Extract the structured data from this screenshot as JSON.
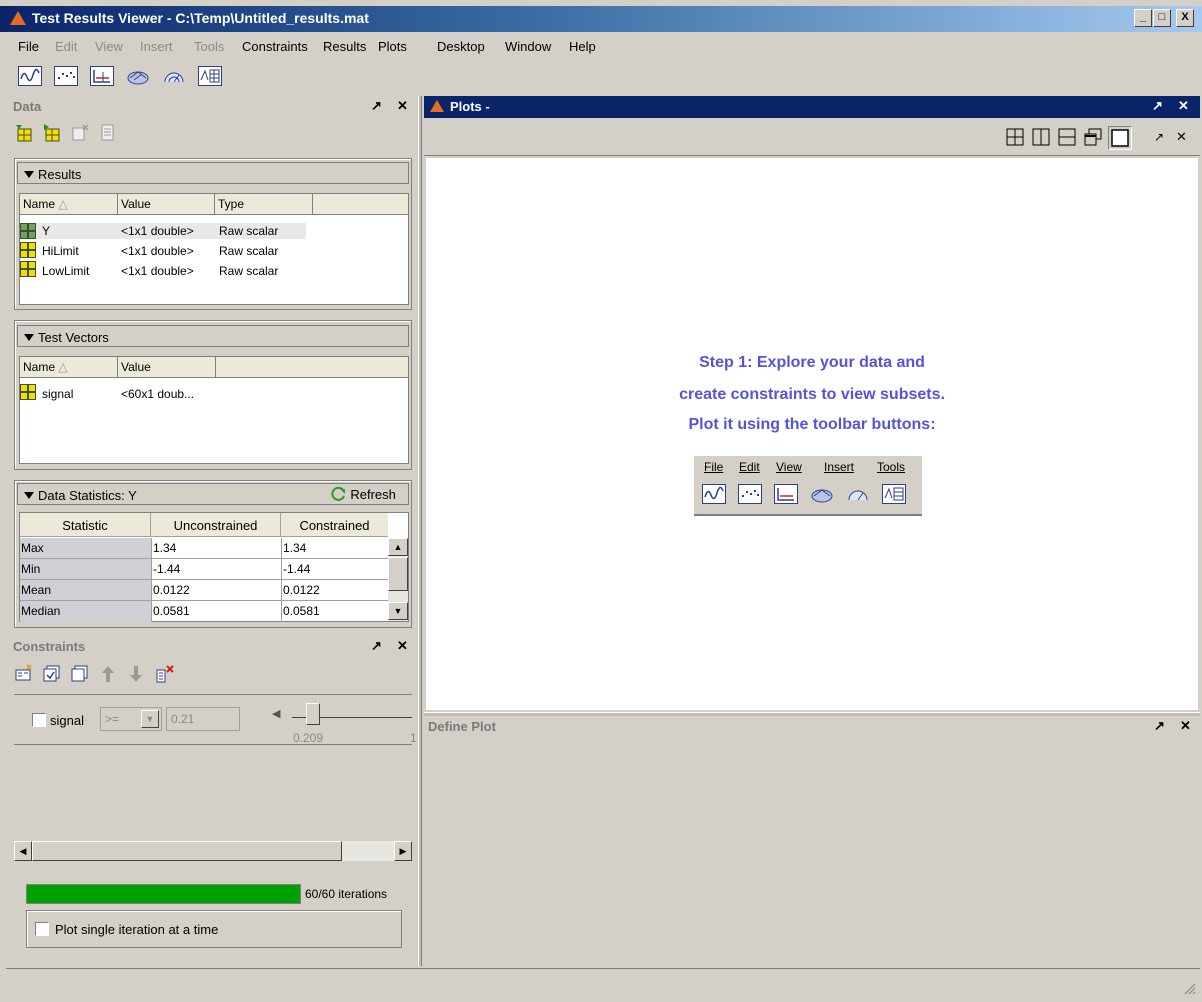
{
  "window": {
    "title": "Test Results Viewer - C:\\Temp\\Untitled_results.mat",
    "min": "_",
    "max": "□",
    "close": "X"
  },
  "menu": [
    {
      "label": "File",
      "enabled": true
    },
    {
      "label": "Edit",
      "enabled": false
    },
    {
      "label": "View",
      "enabled": false
    },
    {
      "label": "Insert",
      "enabled": false
    },
    {
      "label": "Tools",
      "enabled": false
    },
    {
      "label": "Constraints",
      "enabled": true
    },
    {
      "label": "Results",
      "enabled": true
    },
    {
      "label": "Plots",
      "enabled": true
    },
    {
      "label": "Desktop",
      "enabled": true
    },
    {
      "label": "Window",
      "enabled": true
    },
    {
      "label": "Help",
      "enabled": true
    }
  ],
  "toolbar": [
    "line-plot-icon",
    "scatter-plot-icon",
    "limit-plot-icon",
    "surface-plot-icon",
    "polar-plot-icon",
    "table-plot-icon"
  ],
  "data_panel": {
    "title": "Data",
    "undock": "↗",
    "close": "✕",
    "results": {
      "header": "Results",
      "columns": [
        "Name",
        "Value",
        "Type"
      ],
      "rows": [
        {
          "name": "Y",
          "value": "<1x1 double>",
          "type": "Raw scalar"
        },
        {
          "name": "HiLimit",
          "value": "<1x1 double>",
          "type": "Raw scalar"
        },
        {
          "name": "LowLimit",
          "value": "<1x1 double>",
          "type": "Raw scalar"
        }
      ]
    },
    "test_vectors": {
      "header": "Test Vectors",
      "columns": [
        "Name",
        "Value"
      ],
      "rows": [
        {
          "name": "signal",
          "value": "<60x1 doub..."
        }
      ]
    },
    "stats": {
      "header": "Data Statistics: Y",
      "refresh": "Refresh",
      "columns": [
        "Statistic",
        "Unconstrained",
        "Constrained"
      ],
      "rows": [
        {
          "stat": "Max",
          "u": "1.34",
          "c": "1.34"
        },
        {
          "stat": "Min",
          "u": "-1.44",
          "c": "-1.44"
        },
        {
          "stat": "Mean",
          "u": "0.0122",
          "c": "0.0122"
        },
        {
          "stat": "Median",
          "u": "0.0581",
          "c": "0.0581"
        }
      ]
    }
  },
  "constraints_panel": {
    "title": "Constraints",
    "undock": "↗",
    "close": "✕",
    "row": {
      "label": "signal",
      "operator": ">=",
      "value": "0.21",
      "slider_value": "0.209",
      "slider_end": "1",
      "checked": false
    },
    "progress": {
      "fraction": 1.0,
      "label": "60/60 iterations"
    },
    "single_iter": {
      "label": "Plot single iteration at a time",
      "checked": false
    }
  },
  "plots_panel": {
    "title": "Plots -",
    "undock": "↗",
    "close": "✕",
    "step_lines": [
      "Step 1:  Explore your data and",
      "create constraints to view subsets.",
      "Plot it using the toolbar buttons:"
    ],
    "mini_menu": [
      "File",
      "Edit",
      "View",
      "Insert",
      "Tools"
    ]
  },
  "define_plot": {
    "title": "Define Plot",
    "undock": "↗",
    "close": "✕"
  }
}
